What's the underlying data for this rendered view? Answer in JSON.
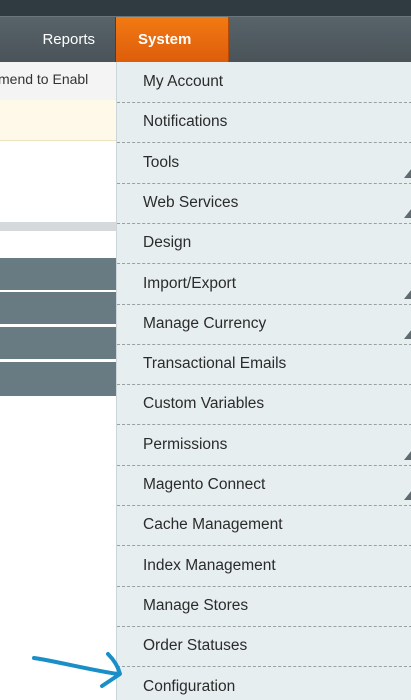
{
  "nav": {
    "reports_label": "Reports",
    "system_label": "System",
    "accent_color": "#e8690e"
  },
  "notice": {
    "text": "mend to Enabl"
  },
  "menu": {
    "items": [
      {
        "label": "My Account",
        "has_submenu": false
      },
      {
        "label": "Notifications",
        "has_submenu": false
      },
      {
        "label": "Tools",
        "has_submenu": true
      },
      {
        "label": "Web Services",
        "has_submenu": true
      },
      {
        "label": "Design",
        "has_submenu": false
      },
      {
        "label": "Import/Export",
        "has_submenu": true
      },
      {
        "label": "Manage Currency",
        "has_submenu": true
      },
      {
        "label": "Transactional Emails",
        "has_submenu": false
      },
      {
        "label": "Custom Variables",
        "has_submenu": false
      },
      {
        "label": "Permissions",
        "has_submenu": true
      },
      {
        "label": "Magento Connect",
        "has_submenu": true
      },
      {
        "label": "Cache Management",
        "has_submenu": false
      },
      {
        "label": "Index Management",
        "has_submenu": false
      },
      {
        "label": "Manage Stores",
        "has_submenu": false
      },
      {
        "label": "Order Statuses",
        "has_submenu": false
      },
      {
        "label": "Configuration",
        "has_submenu": false
      }
    ]
  },
  "annotation": {
    "color": "#1a8fc7",
    "icon": "hand-drawn-arrow-icon"
  }
}
